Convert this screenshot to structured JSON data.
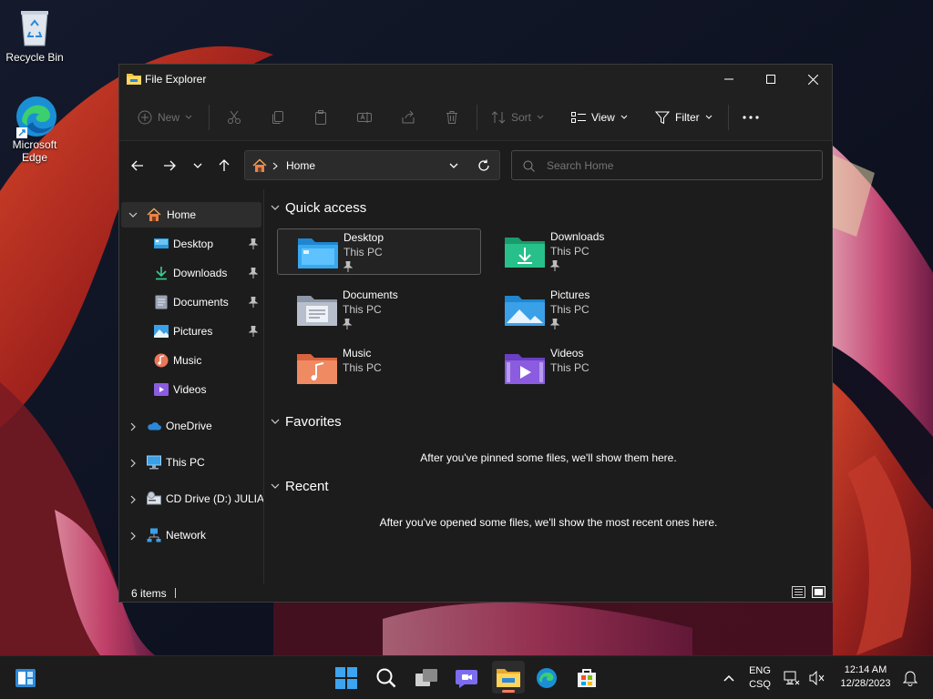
{
  "desktop": {
    "icons": [
      {
        "label": "Recycle Bin"
      },
      {
        "label": "Microsoft Edge"
      }
    ]
  },
  "window": {
    "title": "File Explorer",
    "toolbar": {
      "new_label": "New",
      "sort_label": "Sort",
      "view_label": "View",
      "filter_label": "Filter"
    },
    "address": {
      "location": "Home"
    },
    "search": {
      "placeholder": "Search Home"
    },
    "sidebar": {
      "home": "Home",
      "pinned": [
        {
          "label": "Desktop"
        },
        {
          "label": "Downloads"
        },
        {
          "label": "Documents"
        },
        {
          "label": "Pictures"
        },
        {
          "label": "Music"
        },
        {
          "label": "Videos"
        }
      ],
      "roots": [
        {
          "label": "OneDrive"
        },
        {
          "label": "This PC"
        },
        {
          "label": "CD Drive (D:) JULIA"
        },
        {
          "label": "Network"
        }
      ]
    },
    "content": {
      "quick_access_title": "Quick access",
      "quick_access": [
        {
          "name": "Desktop",
          "location": "This PC",
          "pinned": true
        },
        {
          "name": "Downloads",
          "location": "This PC",
          "pinned": true
        },
        {
          "name": "Documents",
          "location": "This PC",
          "pinned": true
        },
        {
          "name": "Pictures",
          "location": "This PC",
          "pinned": true
        },
        {
          "name": "Music",
          "location": "This PC",
          "pinned": false
        },
        {
          "name": "Videos",
          "location": "This PC",
          "pinned": false
        }
      ],
      "favorites_title": "Favorites",
      "favorites_empty": "After you've pinned some files, we'll show them here.",
      "recent_title": "Recent",
      "recent_empty": "After you've opened some files, we'll show the most recent ones here."
    },
    "status": {
      "items": "6 items"
    }
  },
  "taskbar": {
    "language": "ENG",
    "layout": "CSQ",
    "time": "12:14 AM",
    "date": "12/28/2023"
  },
  "colors": {
    "accent": "#60cdff",
    "window_bg": "#1c1c1c",
    "taskbar_bg": "#1c1c1c"
  }
}
